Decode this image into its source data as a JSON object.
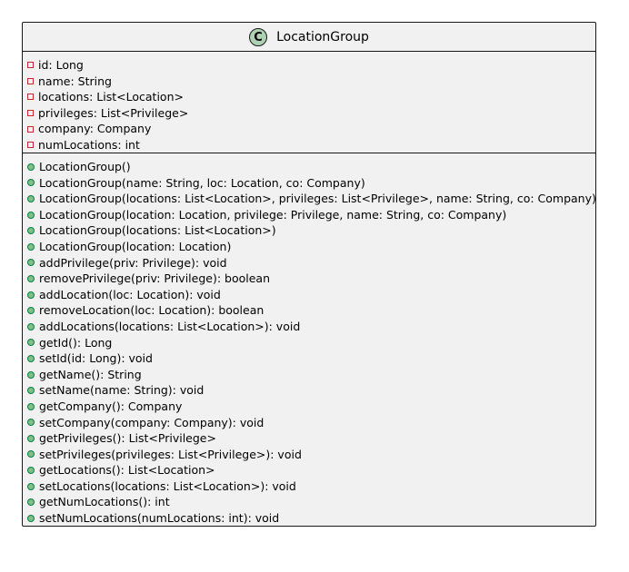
{
  "class": {
    "stereotype_letter": "C",
    "name": "LocationGroup"
  },
  "attributes": [
    {
      "visibility": "private",
      "text": "id: Long"
    },
    {
      "visibility": "private",
      "text": "name: String"
    },
    {
      "visibility": "private",
      "text": "locations: List<Location>"
    },
    {
      "visibility": "private",
      "text": "privileges: List<Privilege>"
    },
    {
      "visibility": "private",
      "text": "company: Company"
    },
    {
      "visibility": "private",
      "text": "numLocations: int"
    }
  ],
  "methods": [
    {
      "visibility": "public",
      "text": "LocationGroup()"
    },
    {
      "visibility": "public",
      "text": "LocationGroup(name: String, loc: Location, co: Company)"
    },
    {
      "visibility": "public",
      "text": "LocationGroup(locations: List<Location>, privileges: List<Privilege>, name: String, co: Company)"
    },
    {
      "visibility": "public",
      "text": "LocationGroup(location: Location, privilege: Privilege, name: String, co: Company)"
    },
    {
      "visibility": "public",
      "text": "LocationGroup(locations: List<Location>)"
    },
    {
      "visibility": "public",
      "text": "LocationGroup(location: Location)"
    },
    {
      "visibility": "public",
      "text": "addPrivilege(priv: Privilege): void"
    },
    {
      "visibility": "public",
      "text": "removePrivilege(priv: Privilege): boolean"
    },
    {
      "visibility": "public",
      "text": "addLocation(loc: Location): void"
    },
    {
      "visibility": "public",
      "text": "removeLocation(loc: Location): boolean"
    },
    {
      "visibility": "public",
      "text": "addLocations(locations: List<Location>): void"
    },
    {
      "visibility": "public",
      "text": "getId(): Long"
    },
    {
      "visibility": "public",
      "text": "setId(id: Long): void"
    },
    {
      "visibility": "public",
      "text": "getName(): String"
    },
    {
      "visibility": "public",
      "text": "setName(name: String): void"
    },
    {
      "visibility": "public",
      "text": "getCompany(): Company"
    },
    {
      "visibility": "public",
      "text": "setCompany(company: Company): void"
    },
    {
      "visibility": "public",
      "text": "getPrivileges(): List<Privilege>"
    },
    {
      "visibility": "public",
      "text": "setPrivileges(privileges: List<Privilege>): void"
    },
    {
      "visibility": "public",
      "text": "getLocations(): List<Location>"
    },
    {
      "visibility": "public",
      "text": "setLocations(locations: List<Location>): void"
    },
    {
      "visibility": "public",
      "text": "getNumLocations(): int"
    },
    {
      "visibility": "public",
      "text": "setNumLocations(numLocations: int): void"
    }
  ],
  "colors": {
    "box_background": "#f1f1f1",
    "border": "#181818",
    "class_icon": "#add1b2",
    "private_marker": "#c82930",
    "public_marker_fill": "#84be84",
    "public_marker_border": "#038048"
  }
}
